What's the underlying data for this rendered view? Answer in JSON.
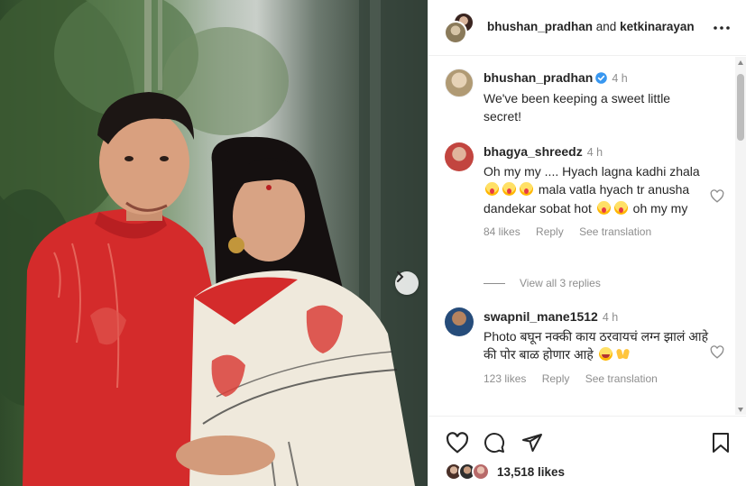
{
  "header": {
    "user1": "bhushan_pradhan",
    "connector": "and",
    "user2": "ketkinarayan",
    "more_icon": "more-horizontal-icon"
  },
  "caption": {
    "username": "bhushan_pradhan",
    "verified": true,
    "time": "4 h",
    "text": "We've been keeping a sweet little secret!"
  },
  "comments": [
    {
      "username": "bhagya_shreedz",
      "time": "4 h",
      "text_parts": [
        "Oh my my .... Hyach lagna kadhi zhala",
        "mala vatla hyach tr anusha dandekar sobat hot",
        "oh my my"
      ],
      "emoji": "face-screaming-icon",
      "likes": "84 likes",
      "reply": "Reply",
      "translate": "See translation",
      "view_replies": "View all 3 replies"
    },
    {
      "username": "swapnil_mane1512",
      "time": "4 h",
      "text": "Photo बघून नक्की काय ठरवायचं लग्न झालं आहे की पोर बाळ होणार आहे",
      "emoji": [
        "laughing-face-icon",
        "raising-hands-icon"
      ],
      "likes": "123 likes",
      "reply": "Reply",
      "translate": "See translation"
    }
  ],
  "actions": {
    "like_icon": "heart-icon",
    "comment_icon": "comment-icon",
    "share_icon": "send-icon",
    "save_icon": "bookmark-icon",
    "likes_count": "13,518 likes"
  },
  "colors": {
    "kurta_red": "#d42b2b",
    "saree_white": "#efe9dc",
    "ganesha_red": "#d9403a",
    "text_primary": "#262626",
    "text_secondary": "#8e8e8e",
    "verified_blue": "#3897f0"
  }
}
